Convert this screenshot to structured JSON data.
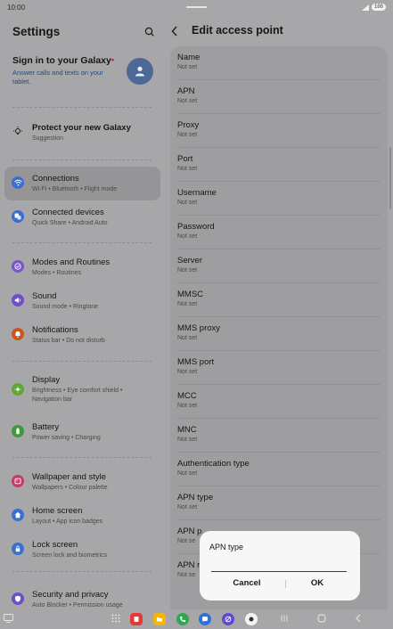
{
  "status_bar": {
    "time": "10:00",
    "battery": "100"
  },
  "settings": {
    "title": "Settings",
    "account": {
      "title": "Sign in to your Galaxy",
      "dot": "•",
      "subtitle": "Answer calls and texts on your tablet."
    },
    "items": [
      {
        "id": "protect",
        "title": "Protect your new Galaxy",
        "subtitle": "Suggestion",
        "icon": "lightbulb-icon",
        "color": "#a7a7a9"
      },
      {
        "id": "connections",
        "title": "Connections",
        "subtitle": "Wi-Fi  •  Bluetooth  •  Flight mode",
        "icon": "wifi-icon",
        "color": "#3a6fd0",
        "selected": true
      },
      {
        "id": "devices",
        "title": "Connected devices",
        "subtitle": "Quick Share  •  Android Auto",
        "icon": "devices-icon",
        "color": "#3a6fd0"
      },
      {
        "id": "modes",
        "title": "Modes and Routines",
        "subtitle": "Modes  •  Routines",
        "icon": "check-circle-icon",
        "color": "#7c54c8"
      },
      {
        "id": "sound",
        "title": "Sound",
        "subtitle": "Sound mode  •  Ringtone",
        "icon": "speaker-icon",
        "color": "#6d4fc6"
      },
      {
        "id": "notifications",
        "title": "Notifications",
        "subtitle": "Status bar  •  Do not disturb",
        "icon": "bell-icon",
        "color": "#c7561f"
      },
      {
        "id": "display",
        "title": "Display",
        "subtitle": "Brightness  •  Eye comfort shield  •",
        "subtitle2": "Navigation bar",
        "icon": "sun-icon",
        "color": "#5ea734"
      },
      {
        "id": "battery",
        "title": "Battery",
        "subtitle": "Power saving  •  Charging",
        "icon": "battery-icon",
        "color": "#3d9a3c"
      },
      {
        "id": "wallpaper",
        "title": "Wallpaper and style",
        "subtitle": "Wallpapers  •  Colour palette",
        "icon": "palette-icon",
        "color": "#c43e6c"
      },
      {
        "id": "home",
        "title": "Home screen",
        "subtitle": "Layout  •  App icon badges",
        "icon": "home-icon",
        "color": "#3a6fd0"
      },
      {
        "id": "lock",
        "title": "Lock screen",
        "subtitle": "Screen lock and biometrics",
        "icon": "lock-icon",
        "color": "#3a6fd0"
      },
      {
        "id": "security",
        "title": "Security and privacy",
        "subtitle": "Auto Blocker  •  Permission usage",
        "icon": "shield-icon",
        "color": "#6d4fc6"
      }
    ]
  },
  "edit_ap": {
    "title": "Edit access point",
    "fields": [
      {
        "label": "Name",
        "value": "Not set"
      },
      {
        "label": "APN",
        "value": "Not set"
      },
      {
        "label": "Proxy",
        "value": "Not set"
      },
      {
        "label": "Port",
        "value": "Not set"
      },
      {
        "label": "Username",
        "value": "Not set"
      },
      {
        "label": "Password",
        "value": "Not set"
      },
      {
        "label": "Server",
        "value": "Not set"
      },
      {
        "label": "MMSC",
        "value": "Not set"
      },
      {
        "label": "MMS proxy",
        "value": "Not set"
      },
      {
        "label": "MMS port",
        "value": "Not set"
      },
      {
        "label": "MCC",
        "value": "Not set"
      },
      {
        "label": "MNC",
        "value": "Not set"
      },
      {
        "label": "Authentication type",
        "value": "Not set"
      },
      {
        "label": "APN type",
        "value": "Not set"
      },
      {
        "label": "APN p",
        "value": "Not se"
      },
      {
        "label": "APN r",
        "value": "Not se"
      }
    ]
  },
  "dialog": {
    "title": "APN type",
    "input_value": "",
    "cancel": "Cancel",
    "ok": "OK"
  },
  "nav_apps": [
    {
      "name": "apps-grid-icon",
      "color": "#7a7a7c"
    },
    {
      "name": "app-red-icon",
      "color": "#e53935"
    },
    {
      "name": "app-folder-icon",
      "color": "#f2b705"
    },
    {
      "name": "app-phone-icon",
      "color": "#2fa84f"
    },
    {
      "name": "app-messages-icon",
      "color": "#2f6fde"
    },
    {
      "name": "app-browser-icon",
      "color": "#5b4bd6"
    },
    {
      "name": "app-camera-icon",
      "color": "#333333"
    }
  ]
}
